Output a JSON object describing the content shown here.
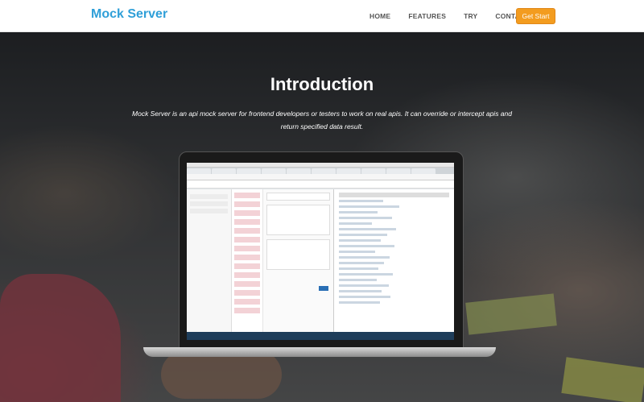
{
  "navbar": {
    "brand": "Mock Server",
    "links": [
      "HOME",
      "FEATURES",
      "TRY",
      "CONTACT"
    ],
    "cta": "Get Start"
  },
  "hero": {
    "title": "Introduction",
    "description": "Mock Server is an api mock server for frontend developers or testers to work on real apis. It can override or intercept apis and return specified data result."
  },
  "colors": {
    "brand": "#2f9fd8",
    "cta": "#f39c1f"
  }
}
